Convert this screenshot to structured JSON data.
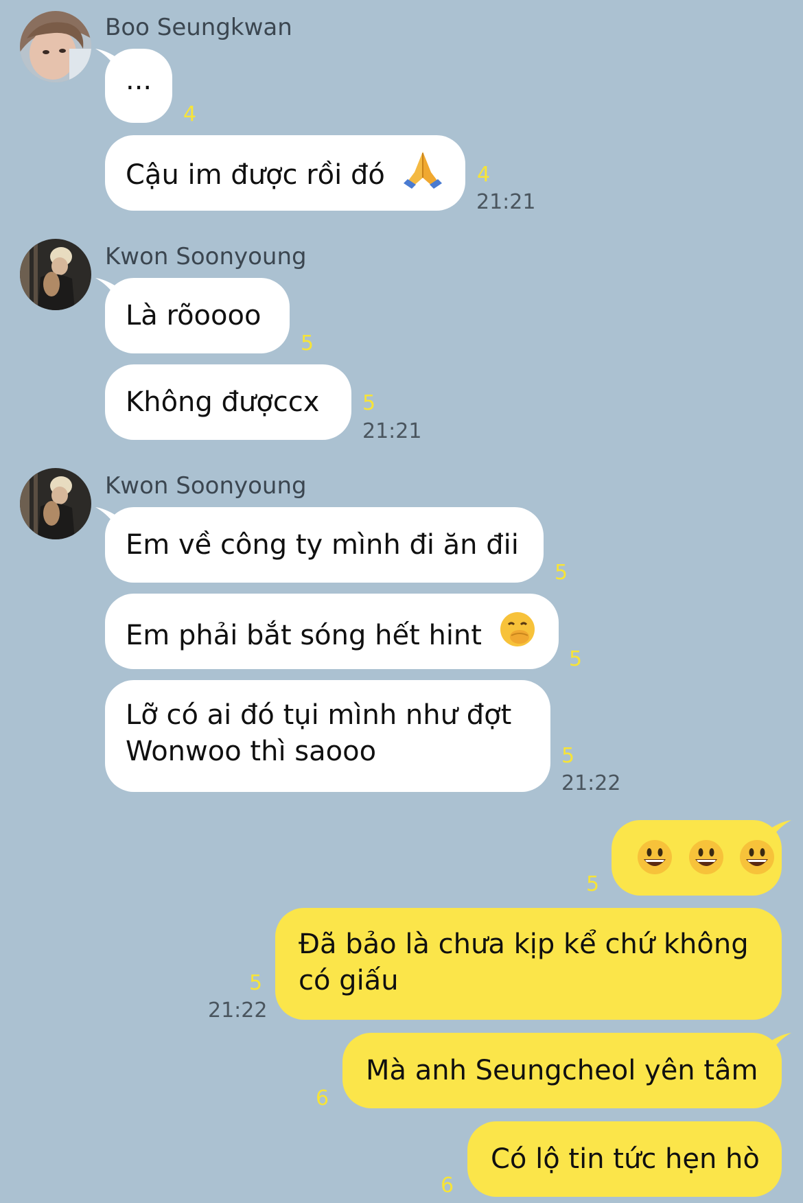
{
  "groups": [
    {
      "sender": "Boo Seungkwan",
      "messages": [
        {
          "text": "...",
          "read_count": "4"
        },
        {
          "text": "Cậu im được rồi đó",
          "emoji": "folded-hands-emoji",
          "read_count": "4",
          "time": "21:21"
        }
      ]
    },
    {
      "sender": "Kwon Soonyoung",
      "messages": [
        {
          "text": "Là rõoooo",
          "read_count": "5"
        },
        {
          "text": "Không đượccx",
          "read_count": "5",
          "time": "21:21"
        }
      ]
    },
    {
      "sender": "Kwon Soonyoung",
      "messages": [
        {
          "text": "Em về công ty mình đi ăn đii",
          "read_count": "5"
        },
        {
          "text": "Em phải bắt sóng hết hint",
          "emoji": "face-with-hand-over-mouth-emoji",
          "read_count": "5"
        },
        {
          "line1": "Lỡ có ai đó tụi mình như đợt",
          "line2": "Wonwoo thì saooo",
          "read_count": "5",
          "time": "21:22"
        }
      ]
    }
  ],
  "outgoing": [
    {
      "emoji": "smiley-emoji-x3",
      "read_count": "5"
    },
    {
      "line1": "Đã bảo là chưa kịp kể chứ không",
      "line2": "có giấu",
      "read_count": "5",
      "time": "21:22"
    },
    {
      "text": "Mà anh Seungcheol yên tâm",
      "read_count": "6"
    },
    {
      "text": "Có lộ tin tức hẹn hò",
      "read_count": "6"
    }
  ],
  "colors": {
    "background": "#abc1d1",
    "incoming_bubble": "#ffffff",
    "outgoing_bubble": "#fbe54a",
    "read_count": "#f7e437",
    "timestamp": "#4a555e"
  }
}
